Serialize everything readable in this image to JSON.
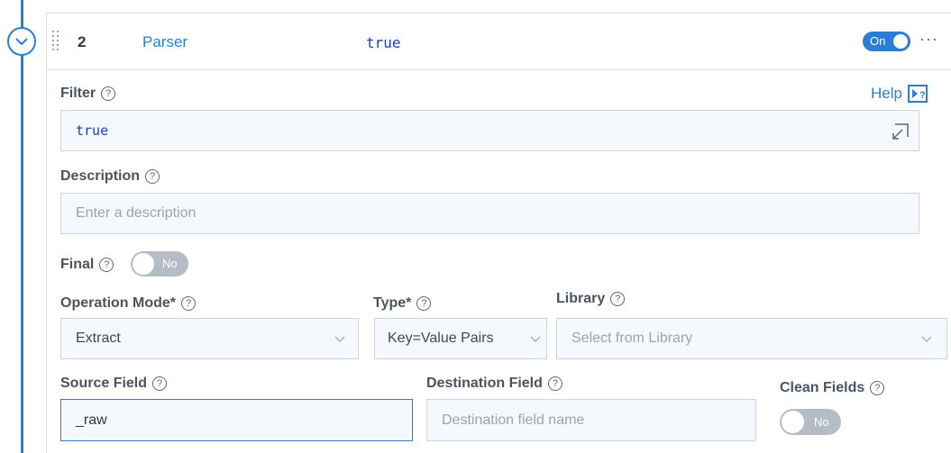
{
  "function": {
    "number": "2",
    "name": "Parser",
    "filter_preview": "true",
    "enabled_label": "On",
    "more_label": "···"
  },
  "help": {
    "label": "Help"
  },
  "filter": {
    "label": "Filter",
    "value": "true"
  },
  "description": {
    "label": "Description",
    "placeholder": "Enter a description"
  },
  "final": {
    "label": "Final",
    "toggle_label": "No"
  },
  "operation_mode": {
    "label": "Operation Mode*",
    "value": "Extract"
  },
  "type": {
    "label": "Type*",
    "value": "Key=Value Pairs"
  },
  "library": {
    "label": "Library",
    "placeholder": "Select from Library"
  },
  "source_field": {
    "label": "Source Field",
    "value": "_raw"
  },
  "destination_field": {
    "label": "Destination Field",
    "placeholder": "Destination field name"
  },
  "clean_fields": {
    "label": "Clean Fields",
    "toggle_label": "No"
  },
  "colors": {
    "accent": "#2a7fd4",
    "code": "#1a3fbf",
    "toggle_off": "#b4bcc5"
  },
  "icons": [
    "chevron-down-icon",
    "drag-handle-icon",
    "help-circle-icon",
    "expand-icon",
    "help-panel-icon"
  ]
}
